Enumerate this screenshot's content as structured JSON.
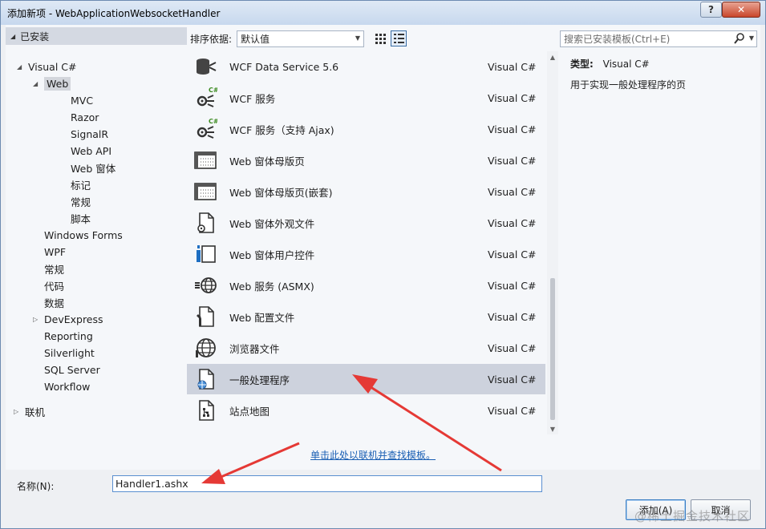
{
  "window": {
    "title": "添加新项 - WebApplicationWebsocketHandler",
    "help_label": "?",
    "close_label": "✕"
  },
  "tree": {
    "installed_label": "已安装",
    "items": [
      {
        "label": "Visual C#",
        "expander": "◢"
      },
      {
        "label": "Web",
        "expander": "◢"
      },
      {
        "label": "MVC"
      },
      {
        "label": "Razor"
      },
      {
        "label": "SignalR"
      },
      {
        "label": "Web API"
      },
      {
        "label": "Web 窗体"
      },
      {
        "label": "标记"
      },
      {
        "label": "常规"
      },
      {
        "label": "脚本"
      },
      {
        "label": "Windows Forms"
      },
      {
        "label": "WPF"
      },
      {
        "label": "常规"
      },
      {
        "label": "代码"
      },
      {
        "label": "数据"
      },
      {
        "label": "DevExpress",
        "expander": "▷"
      },
      {
        "label": "Reporting"
      },
      {
        "label": "Silverlight"
      },
      {
        "label": "SQL Server"
      },
      {
        "label": "Workflow"
      },
      {
        "label": "联机",
        "expander": "▷"
      }
    ]
  },
  "sort": {
    "label": "排序依据:",
    "value": "默认值"
  },
  "templates": [
    {
      "name": "WCF Data Service 5.6",
      "lang": "Visual C#",
      "icon": "data-service-icon"
    },
    {
      "name": "WCF 服务",
      "lang": "Visual C#",
      "icon": "wcf-service-icon"
    },
    {
      "name": "WCF 服务（支持 Ajax)",
      "lang": "Visual C#",
      "icon": "wcf-ajax-service-icon"
    },
    {
      "name": "Web 窗体母版页",
      "lang": "Visual C#",
      "icon": "master-page-icon"
    },
    {
      "name": "Web 窗体母版页(嵌套)",
      "lang": "Visual C#",
      "icon": "nested-master-page-icon"
    },
    {
      "name": "Web 窗体外观文件",
      "lang": "Visual C#",
      "icon": "skin-file-icon"
    },
    {
      "name": "Web 窗体用户控件",
      "lang": "Visual C#",
      "icon": "user-control-icon"
    },
    {
      "name": "Web 服务 (ASMX)",
      "lang": "Visual C#",
      "icon": "asmx-service-icon"
    },
    {
      "name": "Web 配置文件",
      "lang": "Visual C#",
      "icon": "web-config-icon"
    },
    {
      "name": "浏览器文件",
      "lang": "Visual C#",
      "icon": "browser-file-icon"
    },
    {
      "name": "一般处理程序",
      "lang": "Visual C#",
      "icon": "generic-handler-icon"
    },
    {
      "name": "站点地图",
      "lang": "Visual C#",
      "icon": "sitemap-icon"
    }
  ],
  "selected_template_index": 10,
  "online_link": "单击此处以联机并查找模板。",
  "search": {
    "placeholder": "搜索已安装模板(Ctrl+E)"
  },
  "description": {
    "type_label": "类型:",
    "type_value": "Visual C#",
    "text": "用于实现一般处理程序的页"
  },
  "name_field": {
    "label": "名称(N):",
    "value": "Handler1.ashx"
  },
  "buttons": {
    "add": "添加(A)",
    "cancel": "取消"
  },
  "watermark": "@稀土掘金技术社区",
  "colors": {
    "selection": "#cdd2dd",
    "link": "#1a5fb4",
    "arrow": "#e53935"
  }
}
